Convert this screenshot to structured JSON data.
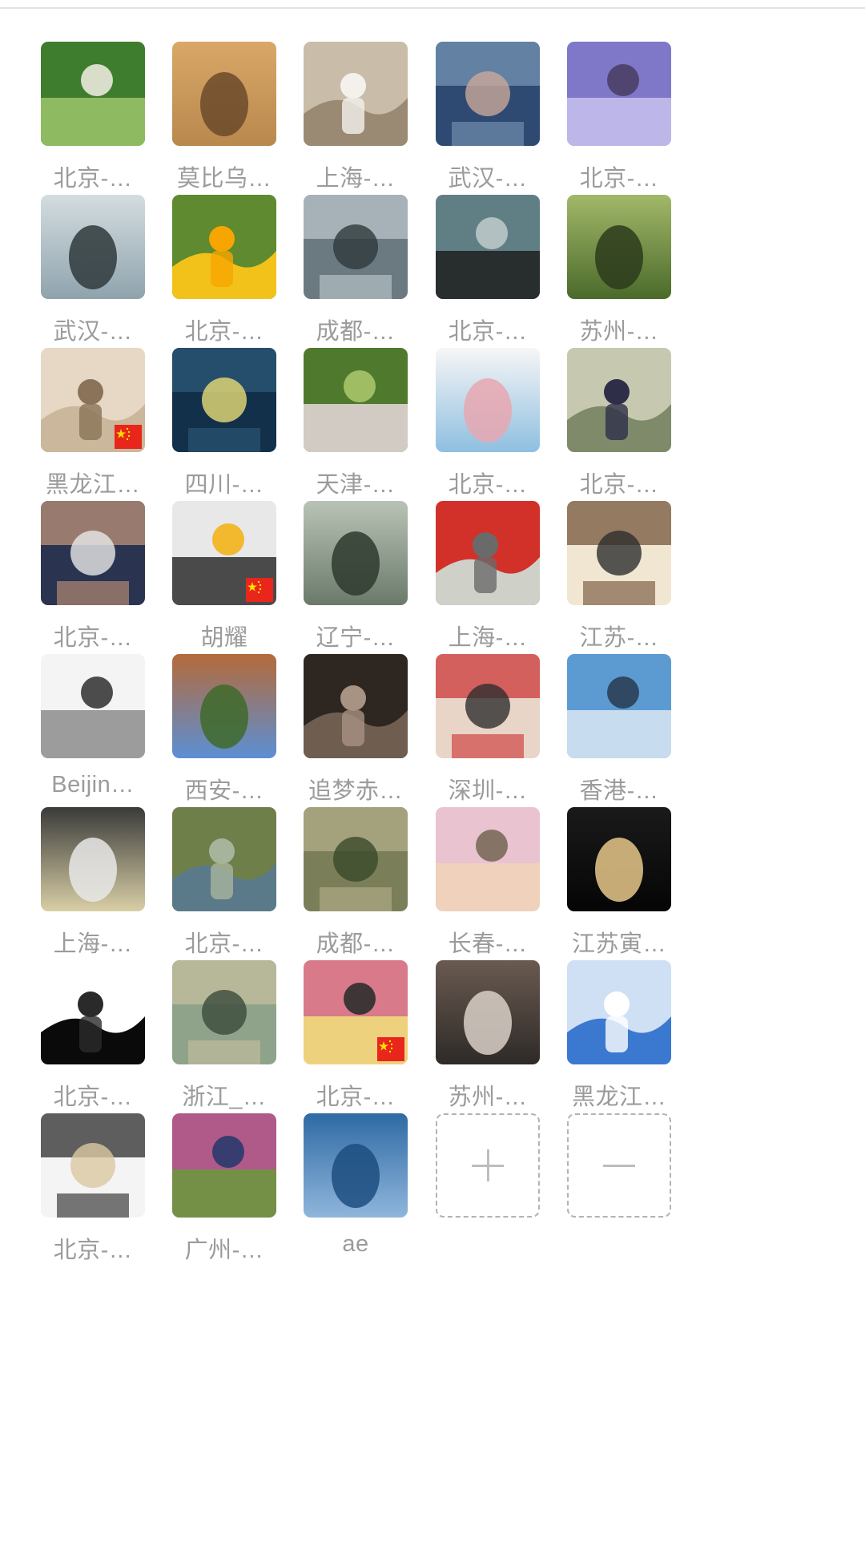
{
  "members": [
    {
      "label": "北京-…",
      "avatar": "dandelion-photo",
      "flag": false
    },
    {
      "label": "莫比乌…",
      "avatar": "keychain-photo",
      "flag": false
    },
    {
      "label": "上海-…",
      "avatar": "white-figure-photo",
      "flag": false
    },
    {
      "label": "武汉-…",
      "avatar": "anime-boy-avatar",
      "flag": false
    },
    {
      "label": "北京-…",
      "avatar": "purple-branches-photo",
      "flag": false
    },
    {
      "label": "武汉-…",
      "avatar": "beach-man-photo",
      "flag": false
    },
    {
      "label": "北京-…",
      "avatar": "sunflower-photo",
      "flag": false
    },
    {
      "label": "成都-…",
      "avatar": "runners-photo",
      "flag": false
    },
    {
      "label": "北京-…",
      "avatar": "silhouette-profile-avatar",
      "flag": false
    },
    {
      "label": "苏州-…",
      "avatar": "trees-photo",
      "flag": false
    },
    {
      "label": "黑龙江…",
      "avatar": "sand-footprints-photo",
      "flag": true
    },
    {
      "label": "四川-…",
      "avatar": "night-lantern-photo",
      "flag": false
    },
    {
      "label": "天津-…",
      "avatar": "pink-hat-photo",
      "flag": false
    },
    {
      "label": "北京-…",
      "avatar": "cartoon-bear-avatar",
      "flag": false
    },
    {
      "label": "北京-…",
      "avatar": "boy-cup-photo",
      "flag": false
    },
    {
      "label": "北京-…",
      "avatar": "sleeping-man-photo",
      "flag": false
    },
    {
      "label": "胡耀",
      "avatar": "penguins-photo",
      "flag": true
    },
    {
      "label": "辽宁-…",
      "avatar": "man-temple-photo",
      "flag": false
    },
    {
      "label": "上海-…",
      "avatar": "toy-plane-photo",
      "flag": false
    },
    {
      "label": "江苏-…",
      "avatar": "sloth-cartoon-avatar",
      "flag": false
    },
    {
      "label": "Beijin…",
      "avatar": "sketch-boy-avatar",
      "flag": false
    },
    {
      "label": "西安-…",
      "avatar": "canyon-photo",
      "flag": false
    },
    {
      "label": "追梦赤…",
      "avatar": "curly-hair-photo",
      "flag": false
    },
    {
      "label": "深圳-…",
      "avatar": "babies-photo",
      "flag": false
    },
    {
      "label": "香港-…",
      "avatar": "sea-sky-photo",
      "flag": false
    },
    {
      "label": "上海-…",
      "avatar": "anime-hat-avatar",
      "flag": false
    },
    {
      "label": "北京-…",
      "avatar": "great-wall-photo",
      "flag": false
    },
    {
      "label": "成都-…",
      "avatar": "river-valley-photo",
      "flag": false
    },
    {
      "label": "长春-…",
      "avatar": "baby-pink-hat-photo",
      "flag": false
    },
    {
      "label": "江苏寅…",
      "avatar": "night-lights-photo",
      "flag": false
    },
    {
      "label": "北京-…",
      "avatar": "goku-sketch-avatar",
      "flag": false
    },
    {
      "label": "浙江_…",
      "avatar": "lake-hills-photo",
      "flag": false
    },
    {
      "label": "北京-…",
      "avatar": "girl-flowers-photo",
      "flag": true
    },
    {
      "label": "苏州-…",
      "avatar": "masked-man-photo",
      "flag": false
    },
    {
      "label": "黑龙江…",
      "avatar": "blue-sky-photo",
      "flag": false
    },
    {
      "label": "北京-…",
      "avatar": "tire-photo",
      "flag": false
    },
    {
      "label": "广州-…",
      "avatar": "couple-flowers-photo",
      "flag": false
    },
    {
      "label": "ae",
      "avatar": "ocean-photo",
      "flag": false
    }
  ],
  "actions": {
    "add_icon": "plus-icon",
    "remove_icon": "minus-icon"
  }
}
